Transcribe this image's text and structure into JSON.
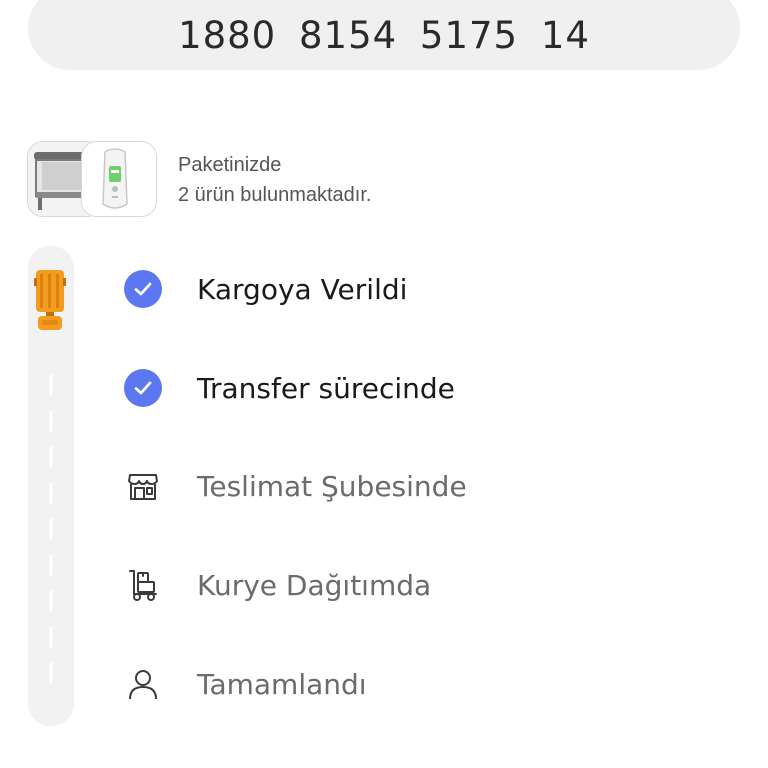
{
  "tracking": {
    "number": "1880  8154  5175  14"
  },
  "package": {
    "line1": "Paketinizde",
    "line2": "2 ürün bulunmaktadır.",
    "thumbnails": [
      "crib-product-icon",
      "thermometer-product-icon"
    ]
  },
  "colors": {
    "accent": "#5b78f0",
    "truck": "#f39c1f",
    "road": "#f2f2f2"
  },
  "steps": [
    {
      "label": "Kargoya Verildi",
      "status": "done",
      "icon": "check-circle-icon"
    },
    {
      "label": "Transfer sürecinde",
      "status": "done",
      "icon": "check-circle-icon"
    },
    {
      "label": "Teslimat Şubesinde",
      "status": "pending",
      "icon": "store-icon"
    },
    {
      "label": "Kurye Dağıtımda",
      "status": "pending",
      "icon": "hand-truck-icon"
    },
    {
      "label": "Tamamlandı",
      "status": "pending",
      "icon": "person-icon"
    }
  ]
}
